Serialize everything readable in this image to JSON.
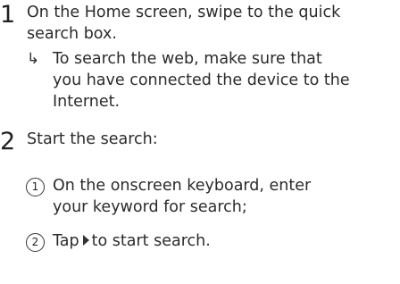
{
  "steps": [
    {
      "number": "1",
      "lines": [
        "On the Home screen, swipe to the quick",
        "search box."
      ],
      "note_lines": [
        "To search the web, make sure that",
        "you have connected the device to the",
        "Internet."
      ]
    },
    {
      "number": "2",
      "text": "Start the search:",
      "substeps": [
        {
          "marker": "1",
          "lines": [
            "On the onscreen keyboard, enter",
            "your keyword for search;"
          ]
        },
        {
          "marker": "2",
          "before_icon": "Tap",
          "after_icon": "to start search."
        }
      ]
    }
  ],
  "icons": {
    "note_arrow": "arrow-return-icon",
    "inline_play": "play-icon"
  }
}
